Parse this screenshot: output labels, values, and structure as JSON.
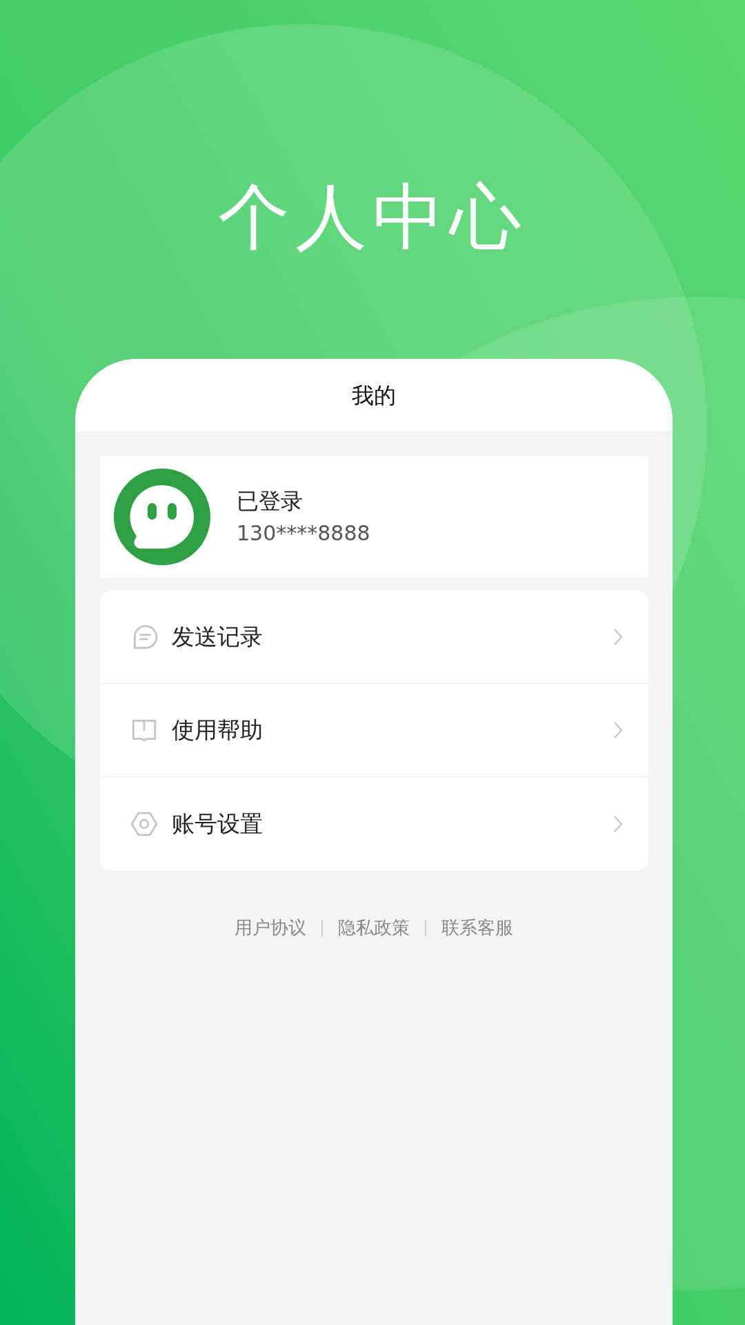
{
  "headline": "个人中心",
  "screen": {
    "title": "我的"
  },
  "profile": {
    "status": "已登录",
    "phone": "130****8888"
  },
  "menu": [
    {
      "label": "发送记录",
      "kind": "records"
    },
    {
      "label": "使用帮助",
      "kind": "help"
    },
    {
      "label": "账号设置",
      "kind": "settings"
    }
  ],
  "footer_links": [
    "用户协议",
    "隐私政策",
    "联系客服"
  ]
}
